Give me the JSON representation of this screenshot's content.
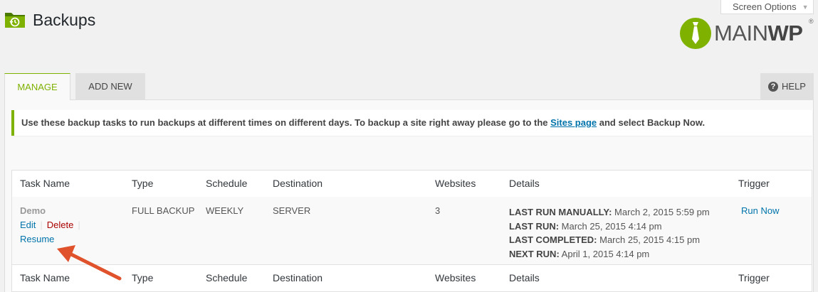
{
  "header": {
    "title": "Backups",
    "screen_options": "Screen Options",
    "logo_main": "MAIN",
    "logo_wp": "WP",
    "logo_reg": "®"
  },
  "tabs": [
    {
      "label": "MANAGE",
      "active": true
    },
    {
      "label": "ADD NEW",
      "active": false
    }
  ],
  "help": {
    "label": "HELP",
    "icon": "question-circle-icon"
  },
  "notice": {
    "text_before": "Use these backup tasks to run backups at different times on different days. To backup a site right away please go to the ",
    "link": "Sites page",
    "text_after": " and select Backup Now."
  },
  "table": {
    "columns": [
      "Task Name",
      "Type",
      "Schedule",
      "Destination",
      "Websites",
      "Details",
      "Trigger"
    ],
    "rows": [
      {
        "name": "Demo",
        "actions": {
          "edit": "Edit",
          "delete": "Delete",
          "resume": "Resume"
        },
        "type": "FULL BACKUP",
        "schedule": "WEEKLY",
        "destination": "SERVER",
        "websites": "3",
        "details": [
          {
            "label": "LAST RUN MANUALLY:",
            "value": " March 2, 2015 5:59 pm"
          },
          {
            "label": "LAST RUN:",
            "value": " March 25, 2015 4:14 pm"
          },
          {
            "label": "LAST COMPLETED:",
            "value": " March 25, 2015 4:15 pm"
          },
          {
            "label": "NEXT RUN:",
            "value": " April 1, 2015 4:14 pm"
          }
        ],
        "trigger": "Run Now"
      }
    ]
  },
  "colors": {
    "accent": "#7fb100",
    "link": "#0073aa",
    "delete": "#aa0000",
    "annotation_arrow": "#e0522c"
  }
}
